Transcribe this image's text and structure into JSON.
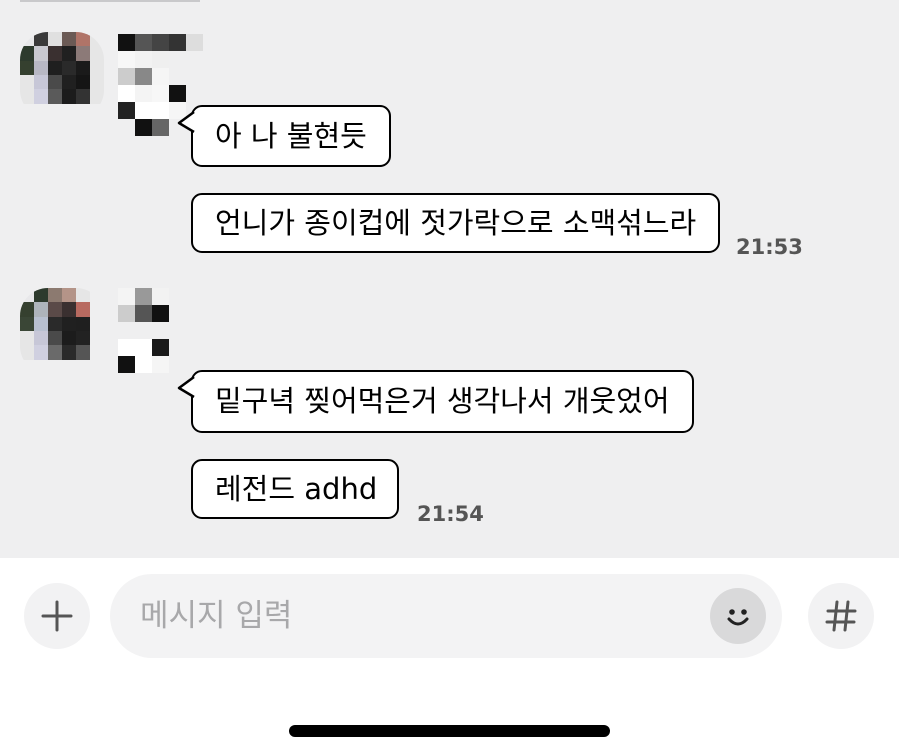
{
  "messages": [
    {
      "text": "아 나 불현듯"
    },
    {
      "text": "언니가 종이컵에 젓가락으로 소맥섞느라",
      "time": "21:53"
    },
    {
      "text": "밑구녁 찢어먹은거 생각나서 개웃었어"
    },
    {
      "text": "레전드 adhd",
      "time": "21:54"
    }
  ],
  "input": {
    "placeholder": "메시지 입력"
  },
  "icons": {
    "add": "plus-icon",
    "emoji": "smiley-icon",
    "hashtag": "hashtag-icon"
  },
  "colors": {
    "chat_bg": "#efeff0",
    "bubble": "#ffffff",
    "bubble_border": "#000000",
    "time": "#555555",
    "input_bg": "#f3f3f4"
  }
}
